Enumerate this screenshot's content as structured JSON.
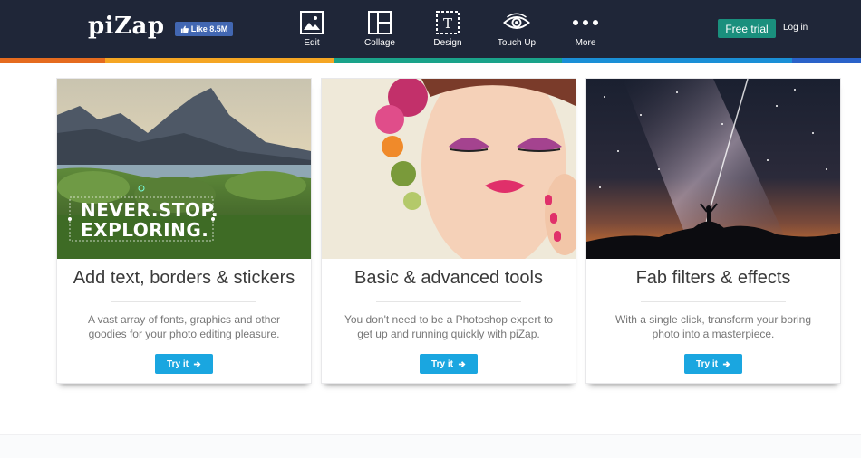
{
  "header": {
    "logo": "piZap",
    "fb_like": "Like 8.5M",
    "nav": [
      {
        "label": "Edit",
        "icon": "image-icon"
      },
      {
        "label": "Collage",
        "icon": "collage-icon"
      },
      {
        "label": "Design",
        "icon": "text-frame-icon"
      },
      {
        "label": "Touch Up",
        "icon": "eye-icon"
      },
      {
        "label": "More",
        "icon": "more-dots-icon"
      }
    ],
    "free_trial": "Free trial",
    "login": "Log in"
  },
  "strip_colors": [
    "#e56b1f",
    "#f5a623",
    "#1aa38a",
    "#1a8fd6",
    "#2a62c9"
  ],
  "colors": {
    "header_bg": "#1f2638",
    "accent_green": "#1a8f7d",
    "button_blue": "#1aa6e0"
  },
  "cards": [
    {
      "title": "Add text, borders & stickers",
      "description": "A vast array of fonts, graphics and other goodies for your photo editing pleasure.",
      "button": "Try it",
      "image_text_line1": "NEVER.STOP.",
      "image_text_line2": "EXPLORING."
    },
    {
      "title": "Basic & advanced tools",
      "description": "You don't need to be a Photoshop expert to get up and running quickly with piZap.",
      "button": "Try it"
    },
    {
      "title": "Fab filters & effects",
      "description": "With a single click, transform your boring photo into a masterpiece.",
      "button": "Try it"
    }
  ]
}
